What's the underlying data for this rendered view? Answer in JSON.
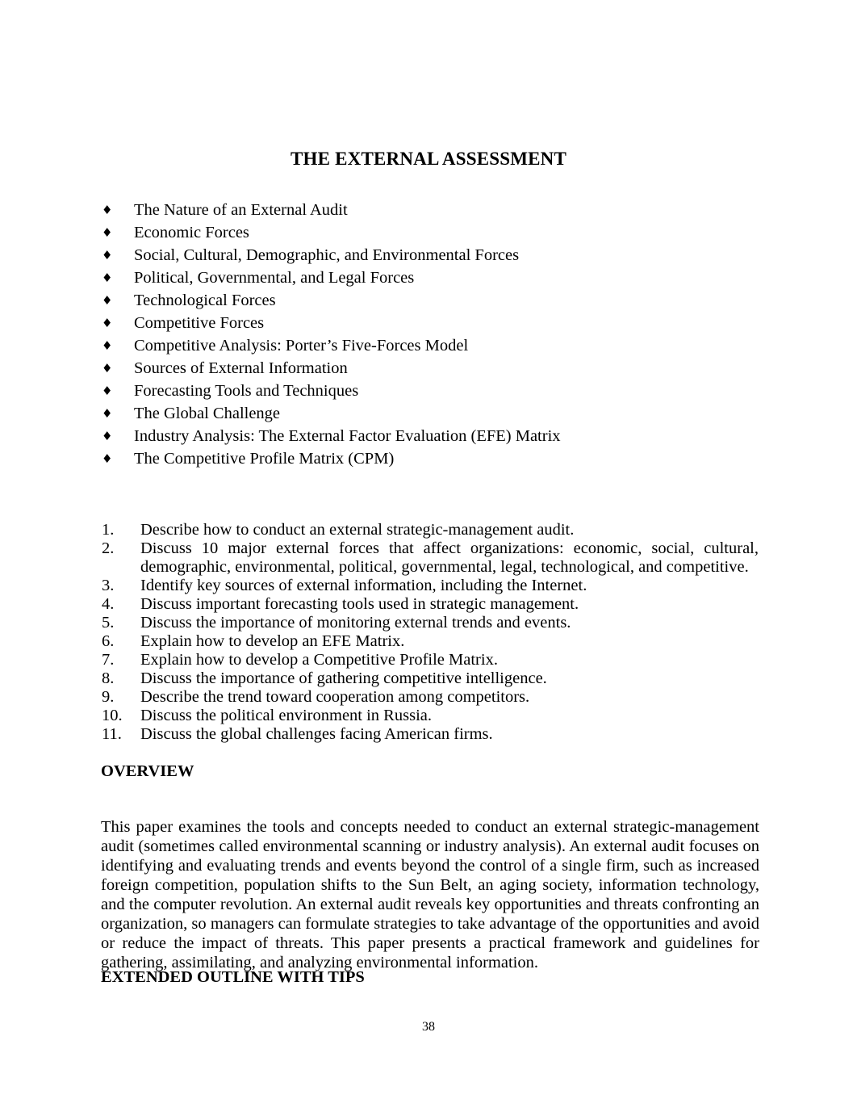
{
  "document": {
    "title": "THE EXTERNAL ASSESSMENT",
    "page_number": "38"
  },
  "bullet_icon": "diamond-bullet",
  "bullet_glyph": "♦",
  "topics": [
    {
      "label": "The Nature of an External Audit"
    },
    {
      "label": "Economic Forces"
    },
    {
      "label": "Social, Cultural, Demographic, and Environmental Forces"
    },
    {
      "label": "Political, Governmental, and Legal Forces"
    },
    {
      "label": "Technological Forces"
    },
    {
      "label": "Competitive Forces"
    },
    {
      "label": "Competitive Analysis: Porter’s Five-Forces Model"
    },
    {
      "label": "Sources of External Information"
    },
    {
      "label": "Forecasting Tools and Techniques"
    },
    {
      "label": "The Global Challenge"
    },
    {
      "label": "Industry Analysis: The External Factor Evaluation (EFE) Matrix"
    },
    {
      "label": "The Competitive Profile Matrix (CPM)"
    }
  ],
  "objectives": [
    {
      "number": "1.",
      "text": "Describe how to conduct an external strategic-management audit.",
      "justified": false
    },
    {
      "number": "2.",
      "text": "Discuss 10 major external forces that affect organizations: economic, social, cultural, demographic, environmental, political, governmental, legal, technological, and competitive.",
      "justified": true
    },
    {
      "number": "3.",
      "text": "Identify key sources of external information, including the Internet.",
      "justified": false
    },
    {
      "number": "4.",
      "text": "Discuss important forecasting tools used in strategic management.",
      "justified": false
    },
    {
      "number": "5.",
      "text": "Discuss the importance of monitoring external trends and events.",
      "justified": false
    },
    {
      "number": "6.",
      "text": "Explain how to develop an EFE Matrix.",
      "justified": false
    },
    {
      "number": "7.",
      "text": "Explain how to develop a Competitive Profile Matrix.",
      "justified": false
    },
    {
      "number": "8.",
      "text": "Discuss the importance of gathering competitive intelligence.",
      "justified": false
    },
    {
      "number": "9.",
      "text": "Describe the trend toward cooperation among competitors.",
      "justified": false
    },
    {
      "number": "10.",
      "text": "Discuss the political environment in Russia.",
      "justified": false
    },
    {
      "number": "11.",
      "text": "Discuss the global challenges facing American firms.",
      "justified": false
    }
  ],
  "sections": {
    "overview": {
      "heading": "OVERVIEW",
      "body": "This paper examines the tools and concepts needed to conduct an external strategic-management audit (sometimes called environmental scanning or industry analysis). An external audit focuses on identifying and evaluating trends and events beyond the control of a single firm, such as increased foreign competition, population shifts to the Sun Belt, an aging society, information technology, and the computer revolution. An external audit reveals key opportunities and threats confronting an organization, so managers can formulate strategies to take advantage of the opportunities and avoid or reduce the impact of threats. This paper presents a practical framework and guidelines for gathering, assimilating, and analyzing environmental information."
    },
    "extended_outline": {
      "heading": "EXTENDED OUTLINE WITH TIPS"
    }
  },
  "colors": {
    "page_background": "#ffffff",
    "text": "#000000"
  }
}
